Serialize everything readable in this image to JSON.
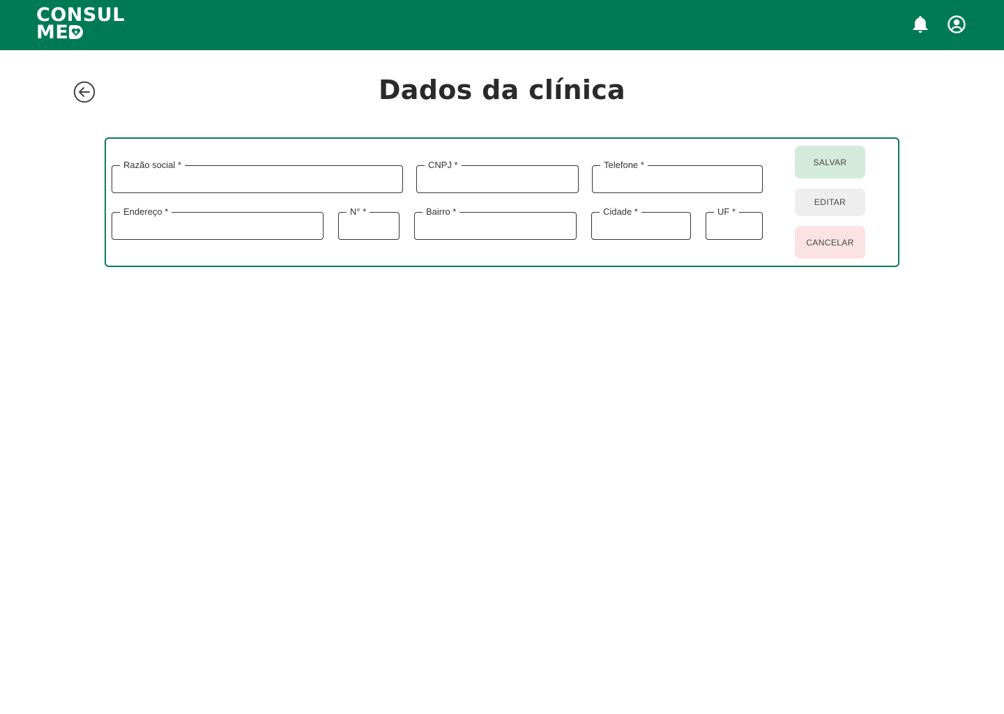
{
  "header": {
    "logo_line1": "CONSUL",
    "logo_line2": "ME",
    "logo_line2_last": "D",
    "brand_color": "#007a55",
    "icons": [
      "bell-icon",
      "user-account-icon"
    ]
  },
  "page": {
    "title": "Dados da clínica",
    "back_icon": "arrow-left-circle-icon"
  },
  "form": {
    "fields": {
      "razao_social": {
        "label": "Razão social *",
        "value": ""
      },
      "cnpj": {
        "label": "CNPJ *",
        "value": ""
      },
      "telefone": {
        "label": "Telefone *",
        "value": ""
      },
      "endereco": {
        "label": "Endereço *",
        "value": ""
      },
      "numero": {
        "label": "N° *",
        "value": ""
      },
      "bairro": {
        "label": "Bairro *",
        "value": ""
      },
      "cidade": {
        "label": "Cidade *",
        "value": ""
      },
      "uf": {
        "label": "UF *",
        "value": ""
      }
    },
    "buttons": {
      "save": "SALVAR",
      "edit": "EDITAR",
      "cancel": "CANCELAR"
    },
    "colors": {
      "border": "#0b7a55",
      "save_bg": "#d4eadb",
      "edit_bg": "#eeeeee",
      "cancel_bg": "#fbe3e3"
    }
  }
}
